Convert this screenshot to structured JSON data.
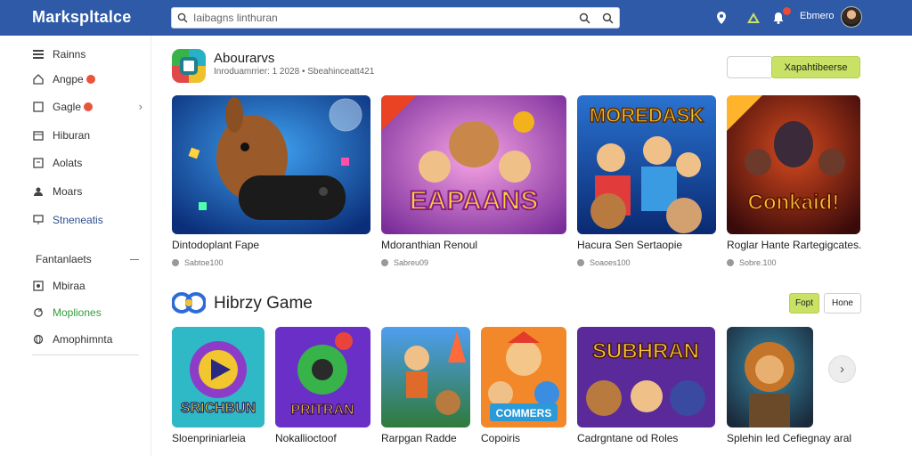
{
  "header": {
    "brand": "Markspltalce",
    "search_placeholder": "Iaibagns linthuran",
    "user_name": "Ebmero"
  },
  "sidebar": {
    "items": [
      {
        "label": "Rainns",
        "icon": "list-icon"
      },
      {
        "label": "Angpe",
        "icon": "home-icon",
        "badge": true
      },
      {
        "label": "Gagle",
        "icon": "square-icon",
        "badge": true,
        "chevron": true
      },
      {
        "label": "Hiburan",
        "icon": "calendar-icon"
      },
      {
        "label": "Aolats",
        "icon": "doc-icon"
      },
      {
        "label": "Moars",
        "icon": "person-icon"
      },
      {
        "label": "Stneneatis",
        "icon": "screen-icon",
        "color": "blue"
      }
    ],
    "section_label": "Fantanlaets",
    "section_items": [
      {
        "label": "Mbiraa",
        "icon": "picture-icon"
      },
      {
        "label": "Mopliones",
        "icon": "refresh-icon",
        "color": "green"
      },
      {
        "label": "Amophimnta",
        "icon": "globe-icon"
      }
    ]
  },
  "section1": {
    "title": "Abourarvs",
    "subtitle": "Inroduamrrier: 1 2028  •  Sbeahinceatt421",
    "ghost_button": "",
    "accent_button": "Xapahtibeerse",
    "cards": [
      {
        "title": "Dintodoplant Fape",
        "meta": "Sabtoe100",
        "art": "bear"
      },
      {
        "title": "Mdoranthian Renoul",
        "meta": "Sabreu09",
        "art": "eapaans",
        "art_text": "EAPAANS"
      },
      {
        "title": "Hacura Sen Sertaopie",
        "meta": "Soaoes100",
        "art": "moredask",
        "art_text": "MOREDASK"
      },
      {
        "title": "Roglar Hante Rartegigcates.",
        "meta": "Sobre.100",
        "art": "conkaid",
        "art_text": "Conkaid!"
      }
    ]
  },
  "section2": {
    "title": "Hibrzy Game",
    "button_accent": "Fopt",
    "button_plain": "Hone",
    "cards": [
      {
        "title": "Sloenpriniarleia",
        "art": "play",
        "art_text": "SRICHBUN"
      },
      {
        "title": "Nokallioctoof",
        "art": "pirman",
        "art_text": "PRITRAN"
      },
      {
        "title": "Rarpgan Radde",
        "art": "runner"
      },
      {
        "title": "Copoiris",
        "art": "comics",
        "art_text": "COMMERS"
      },
      {
        "title": "Cadrgntane od Roles",
        "art": "subhran",
        "art_text": "SUBHRAN"
      },
      {
        "title": "Splehin led Cefiegnay aral",
        "art": "lion"
      }
    ]
  },
  "colors": {
    "topbar": "#2f5aa8",
    "accent": "#c9e265",
    "badge": "#e8553d",
    "green": "#2f9d3a"
  }
}
